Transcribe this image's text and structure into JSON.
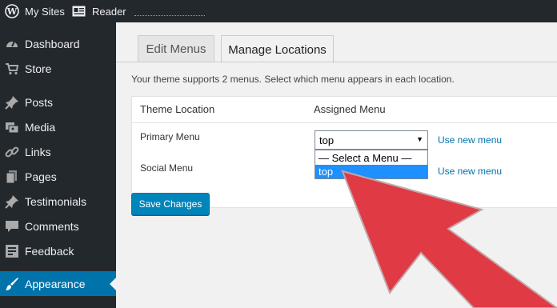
{
  "adminbar": {
    "my_sites": "My Sites",
    "reader": "Reader"
  },
  "sidebar": {
    "items": [
      {
        "label": "Dashboard",
        "icon": "dashboard-icon"
      },
      {
        "label": "Store",
        "icon": "cart-icon"
      },
      {
        "label": "Posts",
        "icon": "pushpin-icon"
      },
      {
        "label": "Media",
        "icon": "media-icon"
      },
      {
        "label": "Links",
        "icon": "link-icon"
      },
      {
        "label": "Pages",
        "icon": "pages-icon"
      },
      {
        "label": "Testimonials",
        "icon": "pushpin-icon"
      },
      {
        "label": "Comments",
        "icon": "comment-icon"
      },
      {
        "label": "Feedback",
        "icon": "feedback-icon"
      },
      {
        "label": "Appearance",
        "icon": "paintbrush-icon",
        "active": true
      }
    ]
  },
  "tabs": {
    "edit_menus": "Edit Menus",
    "manage_locations": "Manage Locations"
  },
  "intro": "Your theme supports 2 menus. Select which menu appears in each location.",
  "table": {
    "col_location": "Theme Location",
    "col_assigned": "Assigned Menu",
    "rows": [
      {
        "location": "Primary Menu",
        "link": "Use new menu"
      },
      {
        "location": "Social Menu",
        "link": "Use new menu"
      }
    ]
  },
  "select": {
    "value": "top",
    "options": [
      "— Select a Menu —",
      "top"
    ]
  },
  "save_button": "Save Changes",
  "colors": {
    "accent": "#0073aa",
    "button": "#0085ba",
    "overlay_arrow": "#e03a45"
  }
}
